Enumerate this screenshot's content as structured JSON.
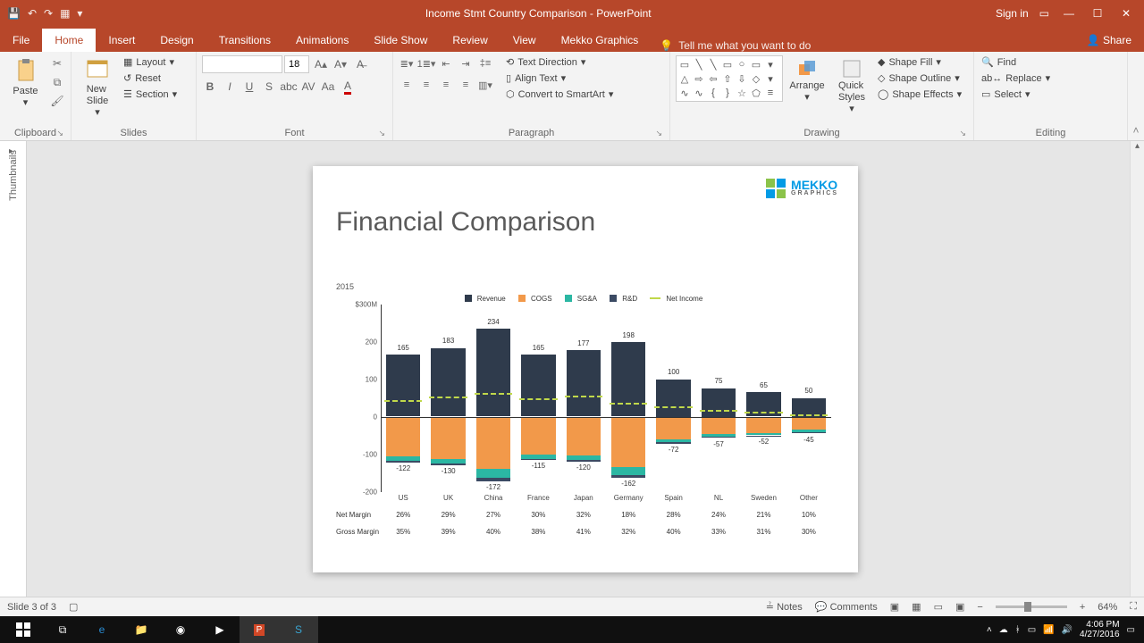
{
  "title": "Income Stmt Country Comparison - PowerPoint",
  "signin": "Sign in",
  "tabs": {
    "file": "File",
    "home": "Home",
    "insert": "Insert",
    "design": "Design",
    "transitions": "Transitions",
    "animations": "Animations",
    "slideshow": "Slide Show",
    "review": "Review",
    "view": "View",
    "mekko": "Mekko Graphics",
    "tellme": "Tell me what you want to do",
    "share": "Share"
  },
  "ribbon": {
    "clipboard": {
      "label": "Clipboard",
      "paste": "Paste"
    },
    "slides": {
      "label": "Slides",
      "new": "New\nSlide",
      "layout": "Layout",
      "reset": "Reset",
      "section": "Section"
    },
    "font": {
      "label": "Font",
      "size": "18"
    },
    "paragraph": {
      "label": "Paragraph",
      "textdir": "Text Direction",
      "align": "Align Text",
      "smartart": "Convert to SmartArt"
    },
    "drawing": {
      "label": "Drawing",
      "arrange": "Arrange",
      "quick": "Quick\nStyles",
      "fill": "Shape Fill",
      "outline": "Shape Outline",
      "effects": "Shape Effects"
    },
    "editing": {
      "label": "Editing",
      "find": "Find",
      "replace": "Replace",
      "select": "Select"
    }
  },
  "thumb": "Thumbnails",
  "slide": {
    "title": "Financial Comparison",
    "logo": "MEKKO",
    "logosub": "GRAPHICS",
    "year": "2015",
    "legend": {
      "rev": "Revenue",
      "cogs": "COGS",
      "sga": "SG&A",
      "rd": "R&D",
      "ni": "Net Income"
    },
    "axis": {
      "top": "$300M",
      "200": "200",
      "100": "100",
      "0": "0",
      "n100": "-100",
      "n200": "-200"
    }
  },
  "chart_data": {
    "type": "bar",
    "title": "Financial Comparison",
    "ylabel": "$M",
    "ylim": [
      -200,
      300
    ],
    "categories": [
      "US",
      "UK",
      "China",
      "France",
      "Japan",
      "Germany",
      "Spain",
      "NL",
      "Sweden",
      "Other"
    ],
    "series": [
      {
        "name": "Revenue",
        "color": "#2f3b4c",
        "values": [
          165,
          183,
          234,
          165,
          177,
          198,
          100,
          75,
          65,
          50
        ]
      },
      {
        "name": "COGS",
        "color": "#f2994a",
        "values": [
          -107,
          -112,
          -140,
          -102,
          -104,
          -135,
          -60,
          -47,
          -45,
          -35
        ]
      },
      {
        "name": "SG&A",
        "color": "#2bb7a3",
        "values": [
          -12,
          -14,
          -24,
          -10,
          -12,
          -20,
          -9,
          -7,
          -5,
          -7
        ]
      },
      {
        "name": "R&D",
        "color": "#3b4a63",
        "values": [
          -3,
          -4,
          -8,
          -3,
          -4,
          -7,
          -3,
          -3,
          -2,
          -3
        ]
      },
      {
        "name": "Net Income",
        "style": "dashed",
        "color": "#c0d84a",
        "values": [
          43,
          53,
          62,
          50,
          57,
          36,
          28,
          18,
          13,
          5
        ]
      }
    ],
    "neg_totals": [
      -122,
      -130,
      -172,
      -115,
      -120,
      -162,
      -72,
      -57,
      -52,
      -45
    ],
    "metrics": [
      {
        "name": "Net Margin",
        "values": [
          "26%",
          "29%",
          "27%",
          "30%",
          "32%",
          "18%",
          "28%",
          "24%",
          "21%",
          "10%"
        ]
      },
      {
        "name": "Gross Margin",
        "values": [
          "35%",
          "39%",
          "40%",
          "38%",
          "41%",
          "32%",
          "40%",
          "33%",
          "31%",
          "30%"
        ]
      }
    ]
  },
  "status": {
    "slide": "Slide 3 of 3",
    "notes": "Notes",
    "comments": "Comments",
    "zoom": "64%"
  },
  "tray": {
    "time": "4:06 PM",
    "date": "4/27/2016"
  }
}
